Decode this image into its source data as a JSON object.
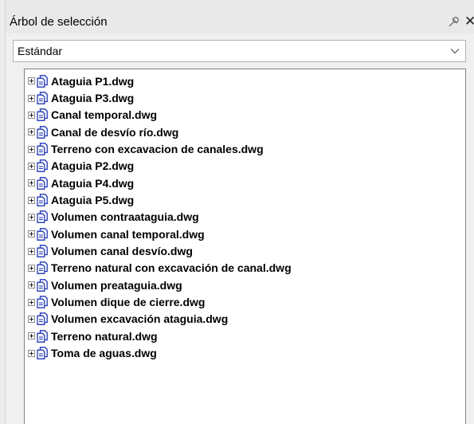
{
  "panel": {
    "title": "Árbol de selección"
  },
  "dropdown": {
    "selected": "Estándar"
  },
  "tree": {
    "items": [
      {
        "label": "Ataguia P1.dwg"
      },
      {
        "label": "Ataguia P3.dwg"
      },
      {
        "label": "Canal temporal.dwg"
      },
      {
        "label": "Canal de desvío río.dwg"
      },
      {
        "label": "Terreno con excavacion de canales.dwg"
      },
      {
        "label": "Ataguia P2.dwg"
      },
      {
        "label": "Ataguia P4.dwg"
      },
      {
        "label": "Ataguia P5.dwg"
      },
      {
        "label": "Volumen contraataguia.dwg"
      },
      {
        "label": "Volumen canal temporal.dwg"
      },
      {
        "label": "Volumen canal desvío.dwg"
      },
      {
        "label": "Terreno natural con excavación de canal.dwg"
      },
      {
        "label": "Volumen preataguia.dwg"
      },
      {
        "label": "Volumen dique de cierre.dwg"
      },
      {
        "label": "Volumen excavación ataguia.dwg"
      },
      {
        "label": "Terreno natural.dwg"
      },
      {
        "label": "Toma de aguas.dwg"
      }
    ]
  },
  "icons": {
    "expand": "expand-plus-icon",
    "file": "dwg-file-icon",
    "pin": "pin-icon",
    "close": "close-icon",
    "dropdown": "chevron-down-icon"
  },
  "colors": {
    "file_icon": "#1f36b8",
    "panel_bg": "#f0f0f0",
    "tree_bg": "#ffffff"
  }
}
